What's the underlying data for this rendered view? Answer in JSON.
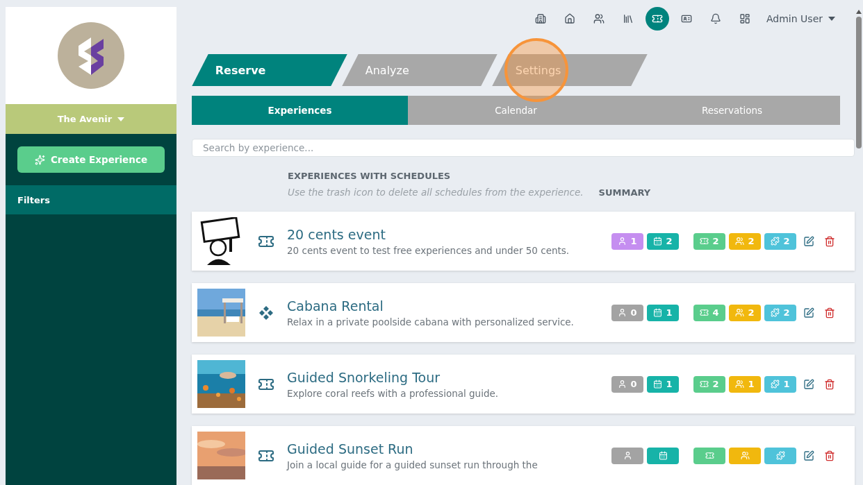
{
  "sidebar": {
    "venue": "The Avenir",
    "create_button": "Create Experience",
    "filters_label": "Filters"
  },
  "topbar": {
    "icons": [
      {
        "kind": "building",
        "selected": false
      },
      {
        "kind": "home",
        "selected": false
      },
      {
        "kind": "users",
        "selected": false
      },
      {
        "kind": "library",
        "selected": false
      },
      {
        "kind": "ticket",
        "selected": true
      },
      {
        "kind": "card",
        "selected": false
      },
      {
        "kind": "bell",
        "selected": false
      },
      {
        "kind": "dashboard",
        "selected": false
      }
    ],
    "user": "Admin User"
  },
  "main_tabs": [
    {
      "label": "Reserve",
      "selected": true,
      "highlighted": false
    },
    {
      "label": "Analyze",
      "selected": false,
      "highlighted": false
    },
    {
      "label": "Settings",
      "selected": false,
      "highlighted": true
    }
  ],
  "sub_tabs": [
    {
      "label": "Experiences",
      "selected": true
    },
    {
      "label": "Calendar",
      "selected": false
    },
    {
      "label": "Reservations",
      "selected": false
    }
  ],
  "search": {
    "placeholder": "Search by experience..."
  },
  "list_header": {
    "title": "EXPERIENCES WITH SCHEDULES",
    "hint": "Use the trash icon to delete all schedules from the experience.",
    "summary": "SUMMARY"
  },
  "experiences": [
    {
      "kind": "ticket",
      "title": "20 cents event",
      "description": "20 cents event to test free experiences and under 50 cents.",
      "badges": [
        {
          "kind": "person",
          "color": "#c58ef0",
          "count": "1"
        },
        {
          "kind": "calendar",
          "color": "#17b3a8",
          "count": "2"
        },
        {
          "kind": "ticket",
          "color": "#5acd8c",
          "count": "2"
        },
        {
          "kind": "group",
          "color": "#f1b80e",
          "count": "2"
        },
        {
          "kind": "puzzle",
          "color": "#4fc3da",
          "count": "2"
        }
      ]
    },
    {
      "kind": "diamond",
      "title": "Cabana Rental",
      "description": "Relax in a private poolside cabana with personalized service.",
      "badges": [
        {
          "kind": "person",
          "color": "#a3a3a3",
          "count": "0"
        },
        {
          "kind": "calendar",
          "color": "#17b3a8",
          "count": "1"
        },
        {
          "kind": "ticket",
          "color": "#5acd8c",
          "count": "4"
        },
        {
          "kind": "group",
          "color": "#f1b80e",
          "count": "2"
        },
        {
          "kind": "puzzle",
          "color": "#4fc3da",
          "count": "2"
        }
      ]
    },
    {
      "kind": "ticket",
      "title": "Guided Snorkeling Tour",
      "description": "Explore coral reefs with a professional guide.",
      "badges": [
        {
          "kind": "person",
          "color": "#a3a3a3",
          "count": "0"
        },
        {
          "kind": "calendar",
          "color": "#17b3a8",
          "count": "1"
        },
        {
          "kind": "ticket",
          "color": "#5acd8c",
          "count": "2"
        },
        {
          "kind": "group",
          "color": "#f1b80e",
          "count": "1"
        },
        {
          "kind": "puzzle",
          "color": "#4fc3da",
          "count": "1"
        }
      ]
    },
    {
      "kind": "ticket",
      "title": "Guided Sunset Run",
      "description": "Join a local guide for a guided sunset run through the",
      "badges": [
        {
          "kind": "person",
          "color": "#a3a3a3"
        },
        {
          "kind": "calendar",
          "color": "#17b3a8"
        },
        {
          "kind": "ticket",
          "color": "#5acd8c"
        },
        {
          "kind": "group",
          "color": "#f1b80e"
        },
        {
          "kind": "puzzle",
          "color": "#4fc3da"
        }
      ]
    }
  ]
}
